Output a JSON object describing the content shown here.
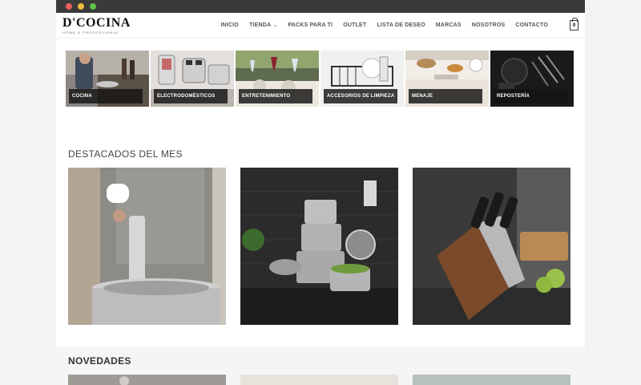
{
  "brand": {
    "name": "D'COCINA",
    "tagline": "HOME & PROFESSIONAL"
  },
  "nav": {
    "items": [
      {
        "label": "INICIO",
        "has_dropdown": false
      },
      {
        "label": "TIENDA",
        "has_dropdown": true
      },
      {
        "label": "PACKS PARA TI",
        "has_dropdown": false
      },
      {
        "label": "OUTLET",
        "has_dropdown": false
      },
      {
        "label": "LISTA DE DESEO",
        "has_dropdown": false
      },
      {
        "label": "MARCAS",
        "has_dropdown": false
      },
      {
        "label": "NOSOTROS",
        "has_dropdown": false
      },
      {
        "label": "CONTACTO",
        "has_dropdown": false
      }
    ],
    "cart_count": "0"
  },
  "categories": [
    {
      "label": "COCINA"
    },
    {
      "label": "ELECTRODOMÉSTICOS"
    },
    {
      "label": "ENTRETENIMIENTO"
    },
    {
      "label": "ACCESORIOS DE LIMPIEZA"
    },
    {
      "label": "MENAJE"
    },
    {
      "label": "REPOSTERÍA"
    }
  ],
  "sections": {
    "featured_title": "DESTACADOS DEL MES",
    "new_title": "NOVEDADES"
  },
  "colors": {
    "titlebar": "#3a3a3a",
    "label_bg": "#141414",
    "text": "#444444"
  }
}
